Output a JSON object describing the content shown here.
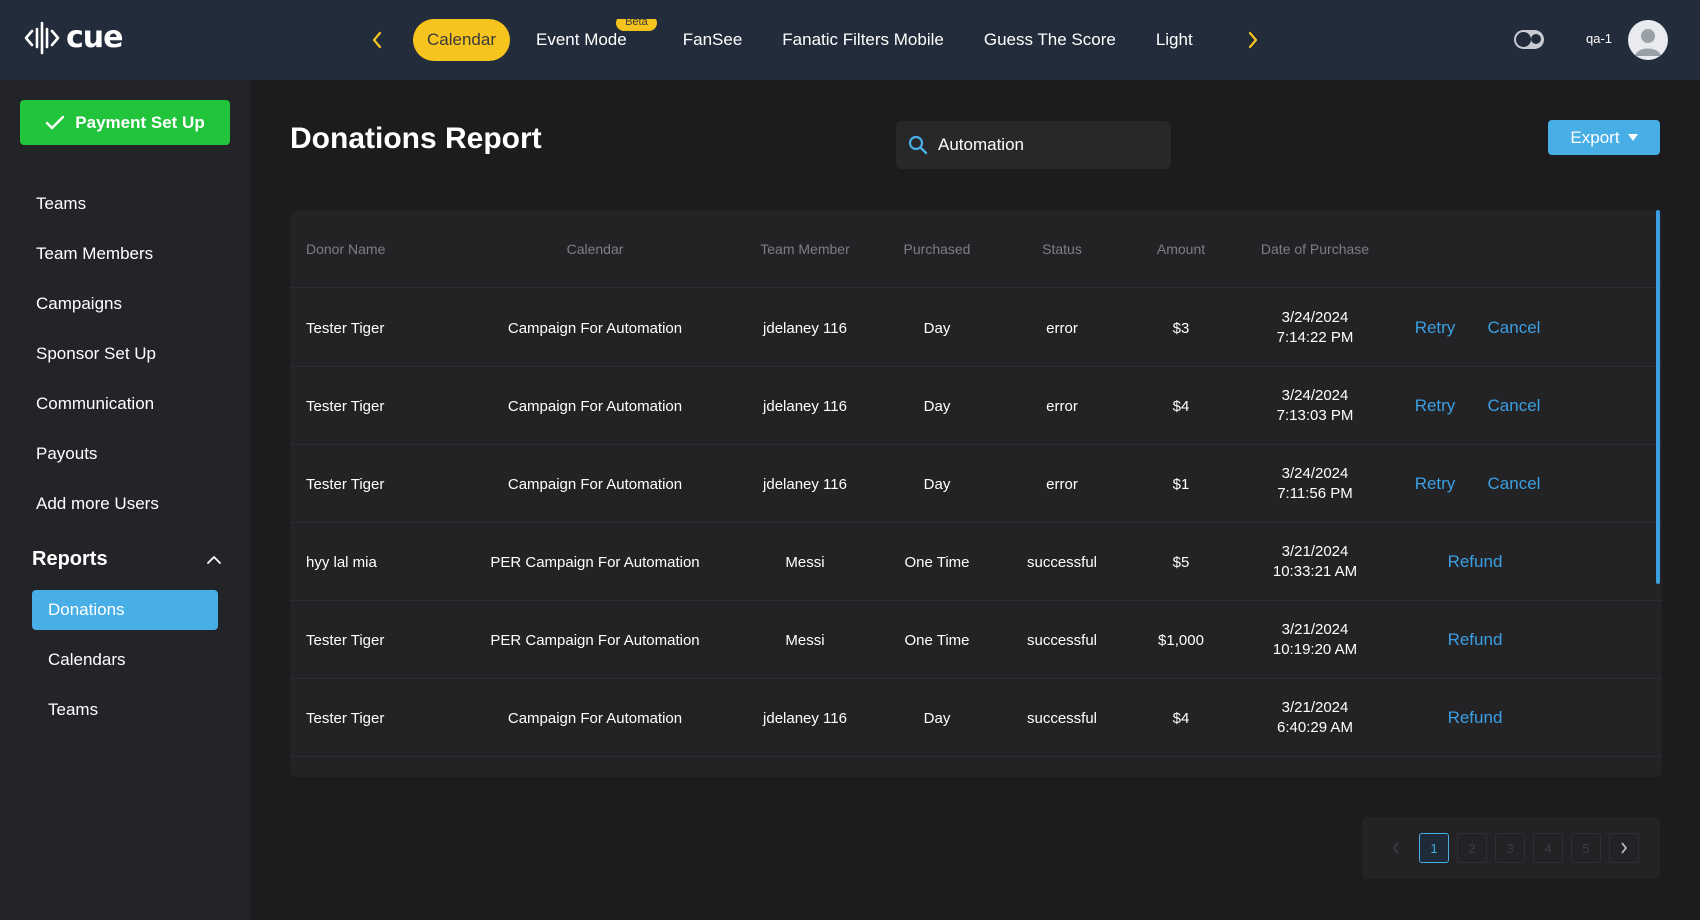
{
  "app": {
    "logo_text": "cue",
    "username": "qa-1"
  },
  "topnav": {
    "tabs": [
      {
        "label": "Calendar",
        "active": true
      },
      {
        "label": "Event Mode",
        "badge": "Beta"
      },
      {
        "label": "FanSee"
      },
      {
        "label": "Fanatic Filters Mobile"
      },
      {
        "label": "Guess The Score"
      },
      {
        "label": "Light"
      }
    ]
  },
  "sidebar": {
    "payment_button": "Payment Set Up",
    "items": [
      {
        "label": "Teams"
      },
      {
        "label": "Team Members"
      },
      {
        "label": "Campaigns"
      },
      {
        "label": "Sponsor Set Up"
      },
      {
        "label": "Communication"
      },
      {
        "label": "Payouts"
      },
      {
        "label": "Add more Users"
      }
    ],
    "reports": {
      "label": "Reports",
      "items": [
        {
          "label": "Donations",
          "active": true
        },
        {
          "label": "Calendars"
        },
        {
          "label": "Teams"
        }
      ]
    }
  },
  "main": {
    "title": "Donations Report",
    "search": {
      "value": "Automation"
    },
    "export_label": "Export"
  },
  "table": {
    "headers": [
      "Donor Name",
      "Calendar",
      "Team Member",
      "Purchased",
      "Status",
      "Amount",
      "Date of Purchase"
    ],
    "rows": [
      {
        "donor": "Tester Tiger",
        "calendar": "Campaign For Automation",
        "member": "jdelaney 116",
        "purchased": "Day",
        "status": "error",
        "amount": "$3",
        "date": "3/24/2024",
        "time": "7:14:22 PM",
        "actions": [
          "Retry",
          "Cancel"
        ]
      },
      {
        "donor": "Tester Tiger",
        "calendar": "Campaign For Automation",
        "member": "jdelaney 116",
        "purchased": "Day",
        "status": "error",
        "amount": "$4",
        "date": "3/24/2024",
        "time": "7:13:03 PM",
        "actions": [
          "Retry",
          "Cancel"
        ]
      },
      {
        "donor": "Tester Tiger",
        "calendar": "Campaign For Automation",
        "member": "jdelaney 116",
        "purchased": "Day",
        "status": "error",
        "amount": "$1",
        "date": "3/24/2024",
        "time": "7:11:56 PM",
        "actions": [
          "Retry",
          "Cancel"
        ]
      },
      {
        "donor": "hyy lal mia",
        "calendar": "PER Campaign For Automation",
        "member": "Messi",
        "purchased": "One Time",
        "status": "successful",
        "amount": "$5",
        "date": "3/21/2024",
        "time": "10:33:21 AM",
        "actions": [
          "Refund"
        ]
      },
      {
        "donor": "Tester Tiger",
        "calendar": "PER Campaign For Automation",
        "member": "Messi",
        "purchased": "One Time",
        "status": "successful",
        "amount": "$1,000",
        "date": "3/21/2024",
        "time": "10:19:20 AM",
        "actions": [
          "Refund"
        ]
      },
      {
        "donor": "Tester Tiger",
        "calendar": "Campaign For Automation",
        "member": "jdelaney 116",
        "purchased": "Day",
        "status": "successful",
        "amount": "$4",
        "date": "3/21/2024",
        "time": "6:40:29 AM",
        "actions": [
          "Refund"
        ]
      }
    ]
  },
  "pagination": {
    "pages": [
      "1",
      "2",
      "3",
      "4",
      "5"
    ],
    "current": "1"
  },
  "colors": {
    "accent": "#48aee6",
    "nav_active": "#f6c41c",
    "success_button": "#22c43c",
    "link": "#3b9fe2"
  }
}
